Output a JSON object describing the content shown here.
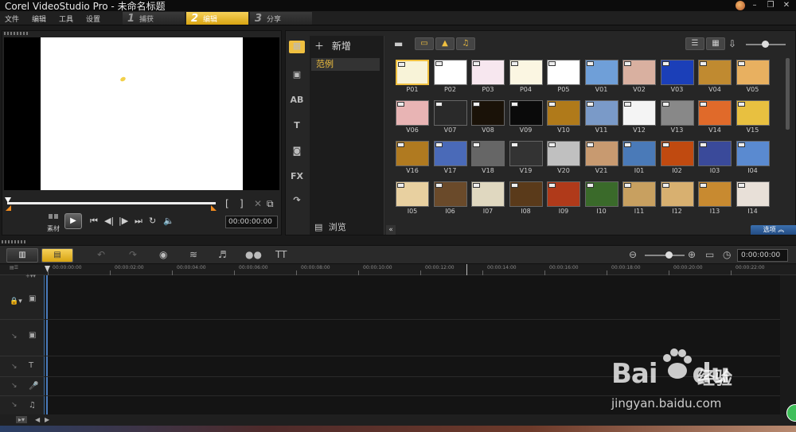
{
  "window": {
    "title": "Corel VideoStudio Pro - 未命名标题"
  },
  "menu": [
    "文件",
    "编辑",
    "工具",
    "设置"
  ],
  "steps": [
    {
      "num": "1",
      "label": "捕获",
      "active": false
    },
    {
      "num": "2",
      "label": "编辑",
      "active": true
    },
    {
      "num": "3",
      "label": "分享",
      "active": false
    }
  ],
  "preview": {
    "mode_label": "素材",
    "timecode": "00:00:00:00"
  },
  "library": {
    "add_label": "新增",
    "folder": "范例",
    "browse_label": "浏览",
    "options_label": "选项",
    "thumbs": [
      "P01",
      "P02",
      "P03",
      "P04",
      "P05",
      "V01",
      "V02",
      "V03",
      "V04",
      "V05",
      "V06",
      "V07",
      "V08",
      "V09",
      "V10",
      "V11",
      "V12",
      "V13",
      "V14",
      "V15",
      "V16",
      "V17",
      "V18",
      "V19",
      "V20",
      "V21",
      "I01",
      "I02",
      "I03",
      "I04",
      "I05",
      "I06",
      "I07",
      "I08",
      "I09",
      "I10",
      "I11",
      "I12",
      "I13",
      "I14"
    ],
    "thumb_colors": [
      "#f8f3d8",
      "#ffffff",
      "#f7e7ef",
      "#fbf6e2",
      "#ffffff",
      "#6f9fd8",
      "#d9b0a0",
      "#1b3fb8",
      "#c08a30",
      "#e8b060",
      "#e8b4b4",
      "#2a2a2a",
      "#1a1208",
      "#0a0a0a",
      "#b07a1a",
      "#7a9ac8",
      "#f4f4f4",
      "#888888",
      "#e06a2a",
      "#e8c040",
      "#b07a20",
      "#4a6ab8",
      "#666666",
      "#333333",
      "#c0c0c0",
      "#c89a70",
      "#4a7ab8",
      "#c04a10",
      "#3a4a9a",
      "#5a8ad0",
      "#e8d0a0",
      "#6a4a2a",
      "#e0d8c0",
      "#5a3a1a",
      "#b03a1a",
      "#3a6a2a",
      "#c8a060",
      "#d8b070",
      "#c88a30",
      "#e8e0d8"
    ]
  },
  "timeline": {
    "timecode": "0:00:00:00",
    "ruler": [
      "00:00:00:00",
      "00:00:02:00",
      "00:00:04:00",
      "00:00:06:00",
      "00:00:08:00",
      "00:00:10:00",
      "00:00:12:00",
      "00:00:14:00",
      "00:00:16:00",
      "00:00:18:00",
      "00:00:20:00",
      "00:00:22:00"
    ]
  },
  "watermark": {
    "brand": "Bai",
    "brand2": "du",
    "cn": "经验",
    "url": "jingyan.baidu.com"
  },
  "icons": {
    "close": "close-icon",
    "minimize": "minimize-icon",
    "maximize": "maximize-icon",
    "play": "play-icon",
    "undo": "undo-icon",
    "redo": "redo-icon"
  }
}
